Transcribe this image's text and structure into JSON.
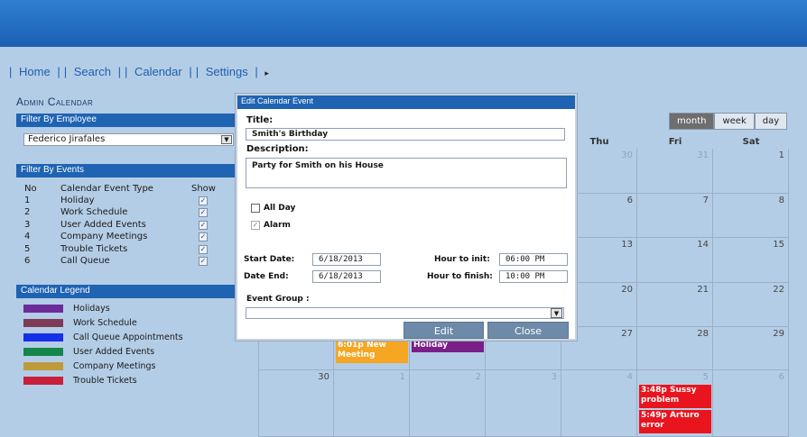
{
  "nav": {
    "items": [
      "Home",
      "Search",
      "Calendar",
      "Settings"
    ],
    "separator": "|",
    "arrow": "▸"
  },
  "page_title": "Admin Calendar",
  "filter_employee": {
    "header": "Filter By Employee",
    "selected": "Federico Jirafales"
  },
  "filter_events": {
    "header": "Filter By Events",
    "col_no": "No",
    "col_type": "Calendar Event Type",
    "col_show": "Show",
    "rows": [
      {
        "no": "1",
        "type": "Holiday",
        "checked": "✓"
      },
      {
        "no": "2",
        "type": "Work Schedule",
        "checked": "✓"
      },
      {
        "no": "3",
        "type": "User Added Events",
        "checked": "✓"
      },
      {
        "no": "4",
        "type": "Company Meetings",
        "checked": "✓"
      },
      {
        "no": "5",
        "type": "Trouble Tickets",
        "checked": "✓"
      },
      {
        "no": "6",
        "type": "Call Queue",
        "checked": "✓"
      }
    ]
  },
  "legend": {
    "header": "Calendar Legend",
    "items": [
      {
        "label": "Holidays",
        "color": "#6b2c9a"
      },
      {
        "label": "Work Schedule",
        "color": "#7e3a57"
      },
      {
        "label": "Call Queue Appointments",
        "color": "#1530e8"
      },
      {
        "label": "User Added Events",
        "color": "#14864a"
      },
      {
        "label": "Company Meetings",
        "color": "#bf9a3a"
      },
      {
        "label": "Trouble Tickets",
        "color": "#c8203a"
      }
    ]
  },
  "view_buttons": {
    "month": "month",
    "week": "week",
    "day": "day"
  },
  "calendar": {
    "headers": [
      "Thu",
      "Fri",
      "Sat"
    ],
    "weeks": [
      [
        "30",
        "31",
        "1"
      ],
      [
        "6",
        "7",
        "8"
      ],
      [
        "13",
        "14",
        "15"
      ],
      [
        "20",
        "21",
        "22"
      ],
      [
        "27",
        "28",
        "29"
      ]
    ],
    "last_week": [
      "30",
      "1",
      "2",
      "3",
      "4",
      "5",
      "6"
    ],
    "events": {
      "meeting": "6:01p New Meeting",
      "holiday": "Holiday",
      "ticket1": "3:48p Sussy problem",
      "ticket2": "5:49p Arturo error"
    }
  },
  "modal": {
    "header": "Edit Calendar Event",
    "title_label": "Title:",
    "title_value": "Smith's Birthday",
    "description_label": "Description:",
    "description_value": "Party for Smith on his House",
    "all_day_label": "All Day",
    "alarm_label": "Alarm",
    "alarm_check": "✓",
    "start_date_label": "Start Date:",
    "start_date_value": "6/18/2013",
    "date_end_label": "Date End:",
    "date_end_value": "6/18/2013",
    "hour_init_label": "Hour to init:",
    "hour_init_value": "06:00 PM",
    "hour_finish_label": "Hour to finish:",
    "hour_finish_value": "10:00 PM",
    "event_group_label": "Event Group :",
    "edit_button": "Edit",
    "close_button": "Close"
  },
  "colors": {
    "accent": "#1f63b3",
    "meeting": "#f5a623",
    "holiday": "#7a1f8a",
    "ticket": "#e8141e"
  }
}
